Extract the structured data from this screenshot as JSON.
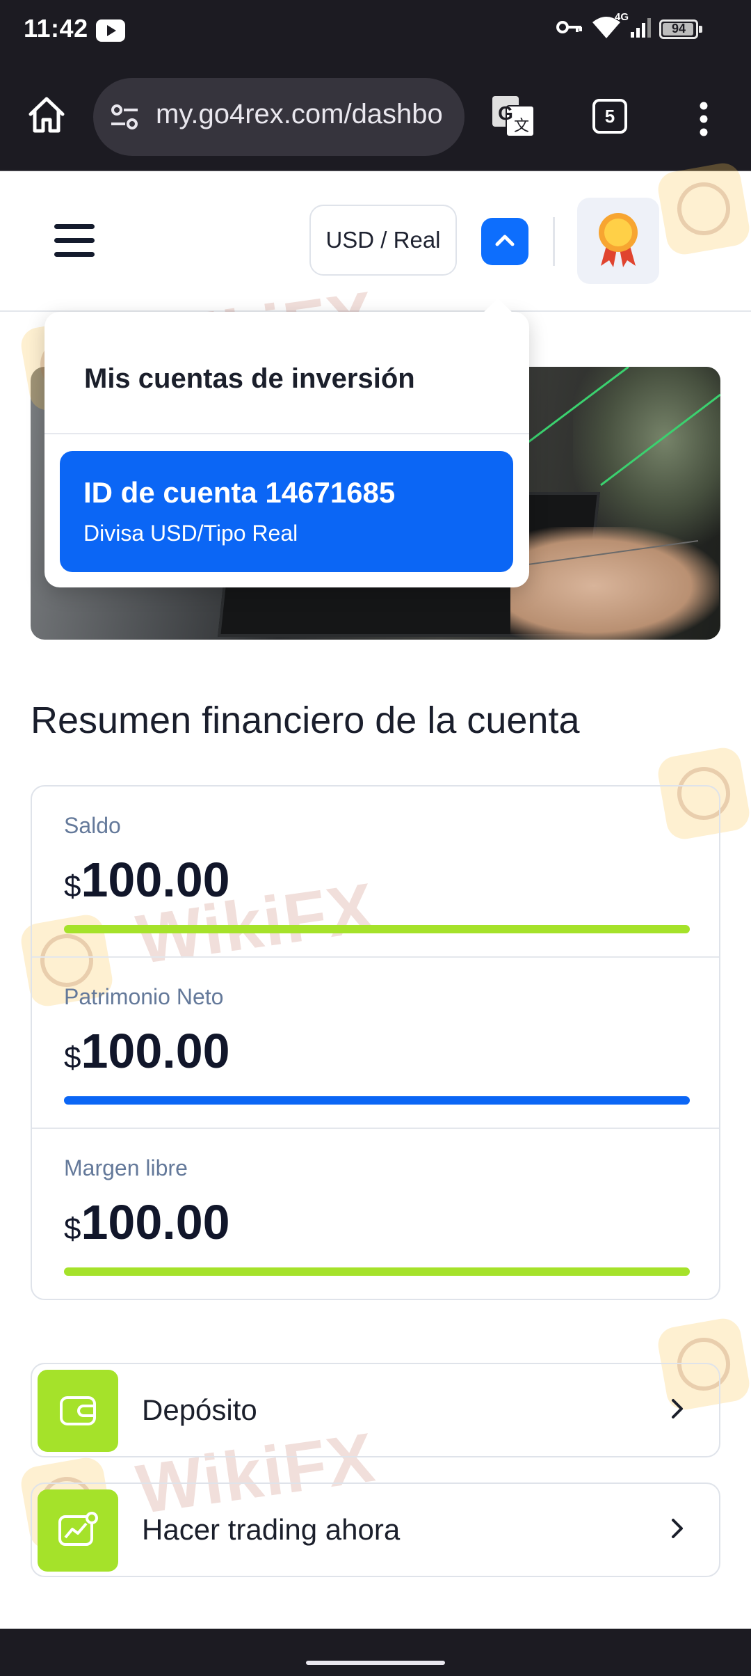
{
  "status_bar": {
    "time": "11:42",
    "network": "4G",
    "battery": "94"
  },
  "browser": {
    "url": "my.go4rex.com/dashbo",
    "tab_count": "5"
  },
  "header": {
    "account_selector": "USD / Real"
  },
  "accounts_dropdown": {
    "title": "Mis cuentas de inversión",
    "items": [
      {
        "id_label": "ID de cuenta 14671685",
        "detail": "Divisa USD/Tipo Real"
      }
    ]
  },
  "summary": {
    "title": "Resumen financiero de la cuenta",
    "metrics": [
      {
        "label": "Saldo",
        "currency": "$",
        "value": "100.00",
        "bar_color": "#a5e22a",
        "bar_fill": 1.0
      },
      {
        "label": "Patrimonio Neto",
        "currency": "$",
        "value": "100.00",
        "bar_color": "#0b66f5",
        "bar_fill": 1.0
      },
      {
        "label": "Margen libre",
        "currency": "$",
        "value": "100.00",
        "bar_color": "#a5e22a",
        "bar_fill": 1.0
      }
    ]
  },
  "actions": [
    {
      "label": "Depósito",
      "icon": "wallet-icon"
    },
    {
      "label": "Hacer trading ahora",
      "icon": "chart-trend-icon"
    }
  ],
  "watermark": {
    "text": "WikiFX"
  },
  "colors": {
    "accent_blue": "#0b66f5",
    "accent_green": "#a5e22a",
    "system_bar": "#1c1b22"
  }
}
